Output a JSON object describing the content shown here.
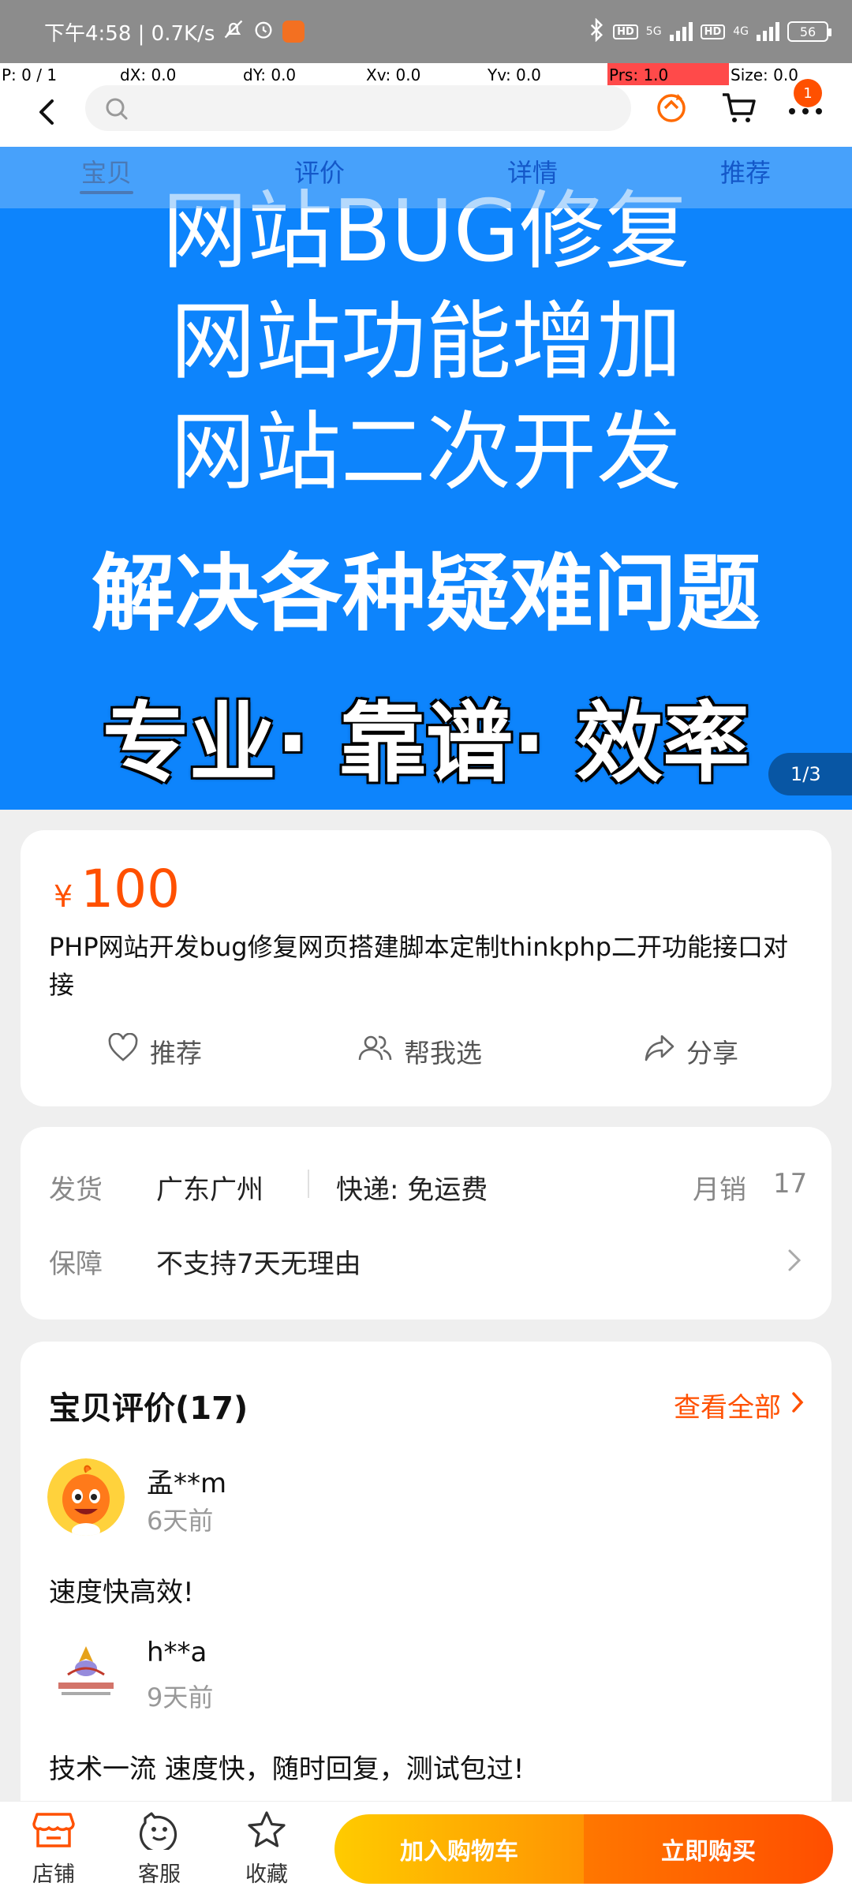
{
  "status_bar": {
    "time_speed": "下午4:58 | 0.7K/s",
    "battery": "56",
    "network_5g": "5G",
    "network_4g": "4G",
    "hd": "HD"
  },
  "debug": {
    "p": "P: 0 / 1",
    "dx": "dX: 0.0",
    "dy": "dY: 0.0",
    "xv": "Xv: 0.0",
    "yv": "Yv: 0.0",
    "prs": "Prs: 1.0",
    "size": "Size: 0.0"
  },
  "header": {
    "search_placeholder": "",
    "cart_badge": "1"
  },
  "tabs": [
    {
      "label": "宝贝",
      "active": true
    },
    {
      "label": "评价",
      "active": false
    },
    {
      "label": "详情",
      "active": false
    },
    {
      "label": "推荐",
      "active": false
    }
  ],
  "banner": {
    "line1": "网站BUG修复",
    "line2": "网站功能增加",
    "line3": "网站二次开发",
    "line4": "解决各种疑难问题",
    "line5": "专业· 靠谱· 效率",
    "pager": "1/3",
    "bg_color": "#0d84fc"
  },
  "product": {
    "currency": "¥",
    "price": "100",
    "title": "PHP网站开发bug修复网页搭建脚本定制thinkphp二开功能接口对接",
    "actions": {
      "recommend": "推荐",
      "help_choose": "帮我选",
      "share": "分享"
    }
  },
  "shipping": {
    "ship_label": "发货",
    "ship_from": "广东广州",
    "express": "快递: 免运费",
    "monthly_sales_label": "月销",
    "monthly_sales_value": "17",
    "guarantee_label": "保障",
    "guarantee_value": "不支持7天无理由"
  },
  "reviews": {
    "title": "宝贝评价(17)",
    "see_all": "查看全部",
    "items": [
      {
        "user": "孟**m",
        "time": "6天前",
        "text": "速度快高效!"
      },
      {
        "user": "h**a",
        "time": "9天前",
        "text": "技术一流 速度快，随时回复，测试包过!"
      }
    ]
  },
  "bottom_bar": {
    "store": "店铺",
    "service": "客服",
    "favorite": "收藏",
    "add_to_cart": "加入购物车",
    "buy_now": "立即购买"
  },
  "colors": {
    "accent": "#ff5000",
    "banner": "#0d84fc"
  }
}
